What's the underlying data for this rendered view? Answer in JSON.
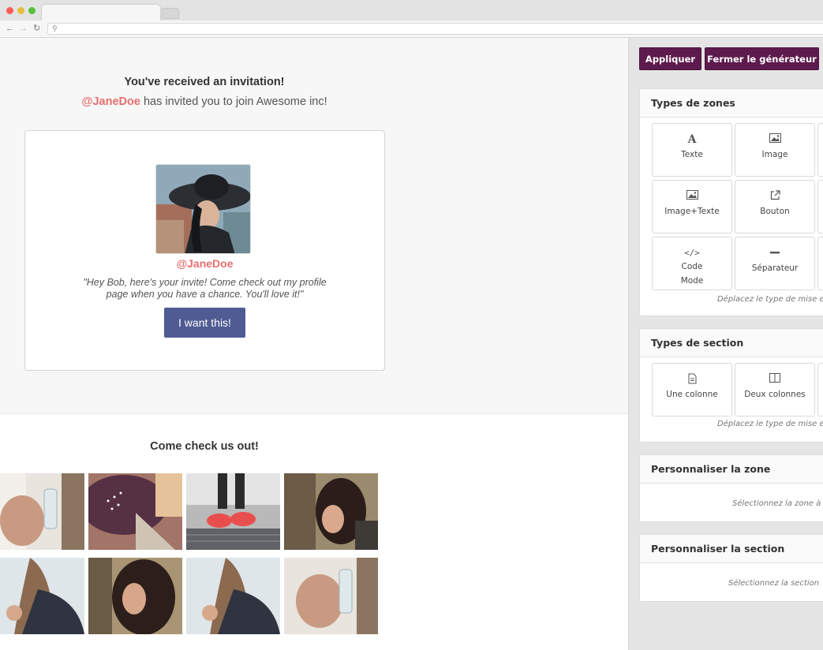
{
  "browser": {
    "nav_back_icon": "arrow-left",
    "nav_forward_icon": "arrow-right",
    "reload_icon": "reload",
    "search_icon": "magnifier"
  },
  "email": {
    "invite_title": "You've received an invitation!",
    "invite_mention": "@JaneDoe",
    "invite_text": " has invited you to join Awesome inc!",
    "card_name": "@JaneDoe",
    "card_quote": "\"Hey Bob, here's your invite! Come check out my profile page when you have a chance. You'll love it!\"",
    "cta_label": "I want this!",
    "gallery_title": "Come check us out!",
    "accent_color": "#e6706f",
    "button_color": "#4f5b93"
  },
  "builder": {
    "apply_label": "Appliquer",
    "close_label": "Fermer le générateur",
    "zones_title": "Types de zones",
    "zones": [
      {
        "label": "Texte",
        "icon": "text-icon"
      },
      {
        "label": "Image",
        "icon": "image-icon"
      },
      {
        "label": "Image+Texte",
        "icon": "image-text-icon"
      },
      {
        "label": "Bouton",
        "icon": "external-link-icon"
      },
      {
        "label": "Code\nMode",
        "icon": "code-icon"
      },
      {
        "label": "Séparateur",
        "icon": "divider-icon"
      }
    ],
    "zones_hint": "Déplacez le type de mise e",
    "sections_title": "Types de section",
    "sections": [
      {
        "label": "Une colonne",
        "icon": "document-icon"
      },
      {
        "label": "Deux colonnes",
        "icon": "columns-icon"
      }
    ],
    "sections_hint": "Déplacez le type de mise e",
    "custom_zone_title": "Personnaliser la zone",
    "custom_zone_hint": "Sélectionnez la zone à",
    "custom_section_title": "Personnaliser la section",
    "custom_section_hint": "Sélectionnez la section",
    "brand_color": "#5d1a4d"
  }
}
